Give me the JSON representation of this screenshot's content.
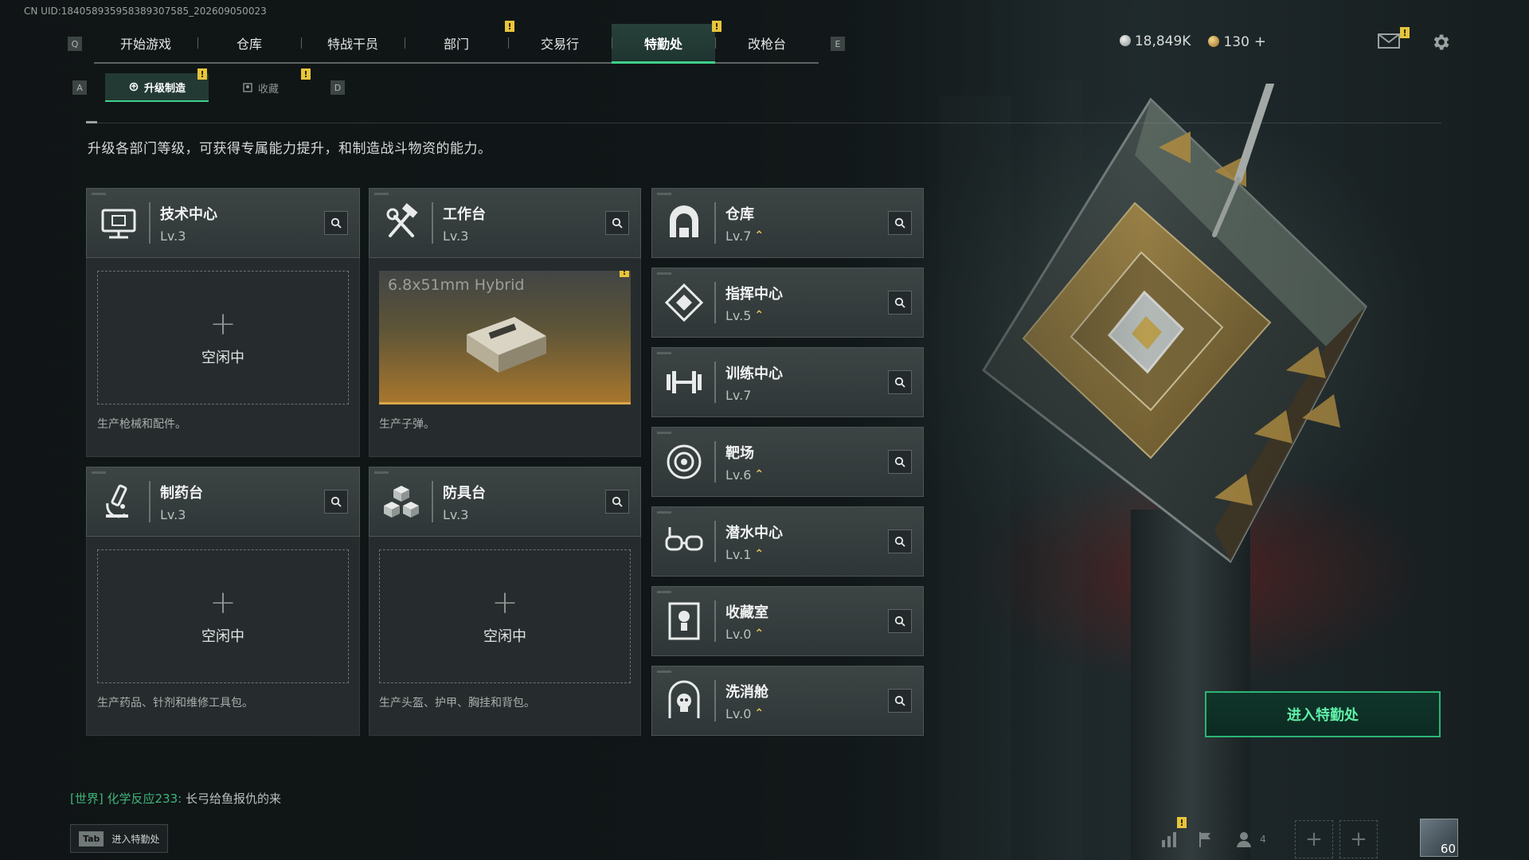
{
  "uid": "CN UID:18405893595838930758​5_202609050023",
  "nav": {
    "left_key": "Q",
    "right_key": "E",
    "tabs": [
      {
        "label": "开始游戏"
      },
      {
        "label": "仓库"
      },
      {
        "label": "特战干员"
      },
      {
        "label": "部门",
        "badge": "!"
      },
      {
        "label": "交易行"
      },
      {
        "label": "特勤处",
        "badge": "!",
        "active": true
      },
      {
        "label": "改枪台"
      }
    ]
  },
  "currency": {
    "silver": "18,849K",
    "gold": "130",
    "add": "+"
  },
  "mail_badge": "!",
  "subnav": {
    "left_key": "A",
    "right_key": "D",
    "tabs": [
      {
        "label": "升级制造",
        "badge": "!",
        "active": true
      },
      {
        "label": "收藏",
        "badge": "!"
      }
    ]
  },
  "description": "升级各部门等级，可获得专属能力提升，和制造战斗物资的能力。",
  "production": [
    {
      "name": "技术中心",
      "level": "Lv.3",
      "icon": "monitor-chip-icon",
      "slot_state": "空闲中",
      "slot_desc": "生产枪械和配件。"
    },
    {
      "name": "工作台",
      "level": "Lv.3",
      "icon": "hammer-wrench-icon",
      "slot_item": "6.8x51mm Hybrid",
      "slot_badge": "!",
      "slot_desc": "生产子弹。"
    },
    {
      "name": "制药台",
      "level": "Lv.3",
      "icon": "microscope-icon",
      "slot_state": "空闲中",
      "slot_desc": "生产药品、针剂和维修工具包。"
    },
    {
      "name": "防具台",
      "level": "Lv.3",
      "icon": "cubes-icon",
      "slot_state": "空闲中",
      "slot_desc": "生产头盔、护甲、胸挂和背包。"
    }
  ],
  "facilities": [
    {
      "name": "仓库",
      "level": "Lv.7",
      "upgradable": true,
      "icon": "warehouse-arch-icon"
    },
    {
      "name": "指挥中心",
      "level": "Lv.5",
      "upgradable": true,
      "icon": "command-diamond-icon"
    },
    {
      "name": "训练中心",
      "level": "Lv.7",
      "upgradable": false,
      "icon": "dumbbell-icon"
    },
    {
      "name": "靶场",
      "level": "Lv.6",
      "upgradable": true,
      "icon": "target-icon"
    },
    {
      "name": "潜水中心",
      "level": "Lv.1",
      "upgradable": true,
      "icon": "diving-goggles-icon"
    },
    {
      "name": "收藏室",
      "level": "Lv.0",
      "upgradable": true,
      "icon": "trophy-case-icon"
    },
    {
      "name": "洗消舱",
      "level": "Lv.0",
      "upgradable": true,
      "icon": "hazmat-skull-icon"
    }
  ],
  "enter_button": "进入特勤处",
  "chat": {
    "channel": "[世界]",
    "user": "化学反应233:",
    "message": "长弓给鱼报仇的来"
  },
  "tab_hint": {
    "key": "Tab",
    "label": "进入特勤处"
  },
  "bottom": {
    "stats_badge": "!",
    "friends_count": "4",
    "player_level": "60",
    "add_slot": "+"
  },
  "colors": {
    "accent_green": "#3fd08a",
    "badge_yellow": "#e7c53b",
    "upgrade_arrow": "#e8c55a",
    "panel": "#3c4444"
  }
}
